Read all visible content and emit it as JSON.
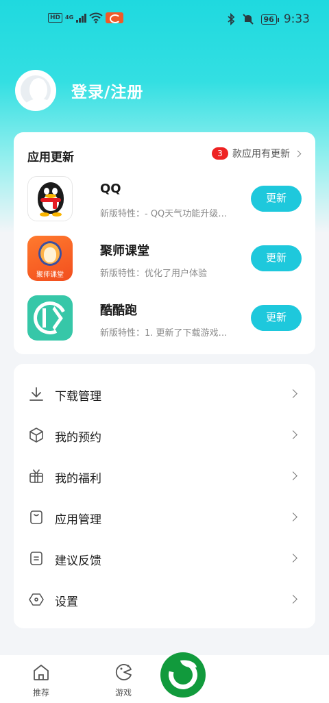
{
  "status_bar": {
    "hd": "HD",
    "network": "4G",
    "battery": "96",
    "time": "9:33"
  },
  "header": {
    "login_label": "登录/注册"
  },
  "app_updates": {
    "title": "应用更新",
    "count": "3",
    "summary": "款应用有更新",
    "button_label": "更新",
    "apps": [
      {
        "name": "QQ",
        "description": "新版特性：- QQ天气功能升级…"
      },
      {
        "name": "聚师课堂",
        "description": "新版特性：优化了用户体验",
        "icon_text": "聚师课堂"
      },
      {
        "name": "酷酷跑",
        "description": "新版特性：1. 更新了下载游戏…"
      }
    ]
  },
  "menu": {
    "items": [
      {
        "label": "下载管理",
        "icon": "download-icon"
      },
      {
        "label": "我的预约",
        "icon": "box-icon"
      },
      {
        "label": "我的福利",
        "icon": "gift-icon"
      },
      {
        "label": "应用管理",
        "icon": "app-manage-icon"
      },
      {
        "label": "建议反馈",
        "icon": "feedback-icon"
      },
      {
        "label": "设置",
        "icon": "settings-icon"
      }
    ]
  },
  "bottom_nav": {
    "items": [
      {
        "label": "推荐",
        "icon": "home-icon"
      },
      {
        "label": "游戏",
        "icon": "game-icon"
      }
    ],
    "center_icon": "leaf-logo-icon"
  },
  "colors": {
    "accent": "#1ec8dc",
    "badge": "#ee2222",
    "brand_green": "#119a3c"
  }
}
